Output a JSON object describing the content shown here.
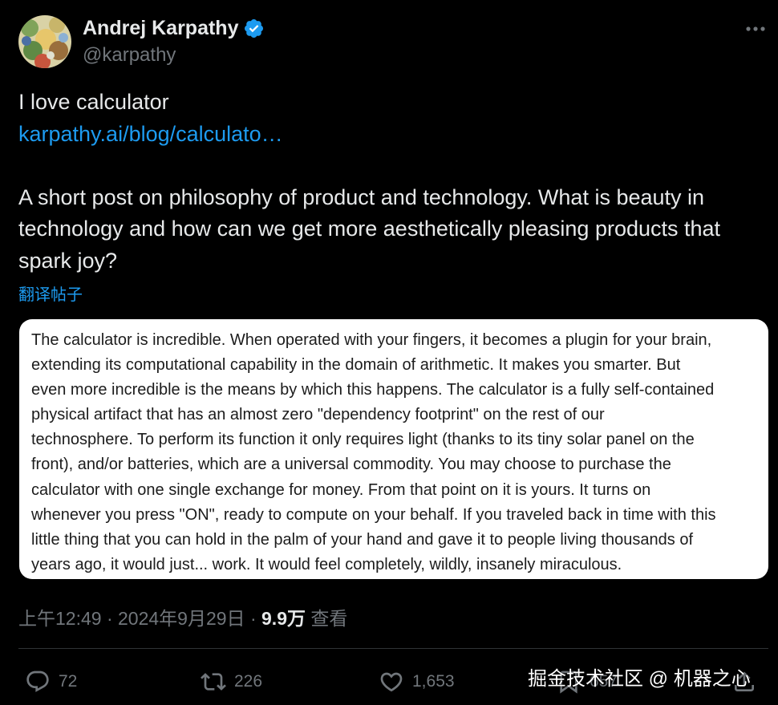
{
  "author": {
    "name": "Andrej Karpathy",
    "handle": "@karpathy",
    "verified_icon": "verified-badge-icon",
    "badge_color": "#1d9bf0"
  },
  "tweet": {
    "line1": "I love calculator",
    "link": "karpathy.ai/blog/calculato…",
    "body": "A short post on philosophy of product and technology. What is beauty in technology and how can we get more aesthetically pleasing products that spark joy?",
    "translate_label": "翻译帖子"
  },
  "image_text": {
    "lines": [
      "The calculator is incredible. When operated with your fingers, it becomes a plugin for your brain,",
      "extending its computational capability in the domain of arithmetic. It makes you smarter. But",
      "even more incredible is the means by which this happens. The calculator is a fully self-contained",
      "physical artifact that has an almost zero \"dependency footprint\" on the rest of our",
      "technosphere. To perform its function it only requires light (thanks to its tiny solar panel on the",
      "front), and/or batteries, which are a universal commodity. You may choose to purchase the",
      "calculator with one single exchange for money. From that point on it is yours. It turns on",
      "whenever you press \"ON\", ready to compute on your behalf. If you traveled back in time with this",
      "little thing that you can hold in the palm of your hand and gave it to people living thousands of",
      "years ago, it would just... work. It would feel completely, wildly, insanely miraculous."
    ]
  },
  "meta": {
    "time": "上午12:49",
    "separator": " · ",
    "date": "2024年9月29日",
    "views_count": "9.9万",
    "views_label": " 查看"
  },
  "actions": {
    "replies": "72",
    "reposts": "226",
    "likes": "1,653",
    "bookmarks": "657"
  },
  "watermark": "掘金技术社区 @ 机器之心",
  "colors": {
    "background": "#000000",
    "text": "#e7e9ea",
    "secondary": "#71767b",
    "link": "#1d9bf0",
    "divider": "#2f3336"
  }
}
